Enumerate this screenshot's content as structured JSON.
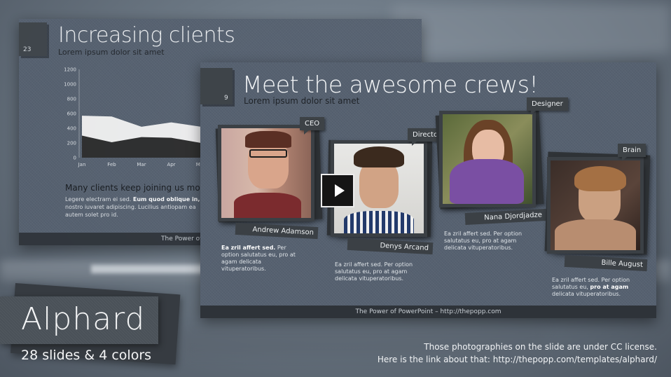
{
  "back_slide": {
    "number": "23",
    "title": "Increasing clients",
    "subtitle": "Lorem ipsum dolor sit amet",
    "heading": "Many clients keep joining us month",
    "text_plain": "Legere electram ei sed.",
    "text_bold": "Eum quod oblique in,",
    "text_rest": "nostro iuvaret adipiscing. Lucilius antiopam ea autem solet pro id.",
    "footer": "The Power of PowerPoint"
  },
  "chart_data": {
    "type": "area",
    "categories": [
      "Jan",
      "Feb",
      "Mar",
      "Apr",
      "May"
    ],
    "ylim": [
      0,
      1200
    ],
    "yticks": [
      "0",
      "200",
      "400",
      "600",
      "800",
      "1000",
      "1200"
    ],
    "series": [
      {
        "values": [
          300,
          210,
          280,
          270,
          200
        ],
        "color": "#2b2b2b"
      },
      {
        "values": [
          570,
          560,
          420,
          480,
          420
        ],
        "color": "#f4f4f4"
      }
    ],
    "grid": false,
    "legend": "none"
  },
  "front_slide": {
    "number": "9",
    "title": "Meet the awesome crews!",
    "subtitle": "Lorem ipsum dolor sit amet",
    "footer": "The Power of PowerPoint – http://thepopp.com",
    "crew": [
      {
        "role": "CEO",
        "name": "Andrew Adamson",
        "desc_bold": "Ea zril affert sed.",
        "desc": "Per option salutatus eu, pro at agam delicata vituperatoribus."
      },
      {
        "role": "Director",
        "name": "Denys Arcand",
        "desc_bold": "",
        "desc": "Ea zril affert sed. Per option salutatus eu, pro at agam delicata vituperatoribus."
      },
      {
        "role": "Designer",
        "name": "Nana Djordjadze",
        "desc_bold": "",
        "desc": "Ea zril affert sed. Per option salutatus eu, pro at agam delicata vituperatoribus."
      },
      {
        "role": "Brain",
        "name": "Bille August",
        "desc_bold": "pro at agam",
        "desc": "Ea zril affert sed. Per option salutatus eu,",
        "desc_end": "delicata vituperatoribus."
      }
    ]
  },
  "brand": {
    "title": "Alphard",
    "subtitle": "28 slides & 4 colors"
  },
  "license": {
    "line1": "Those photographies on the slide are under CC license.",
    "line2": "Here is the link about that: http://thepopp.com/templates/alphard/"
  },
  "icons": {
    "play": "play-icon"
  }
}
